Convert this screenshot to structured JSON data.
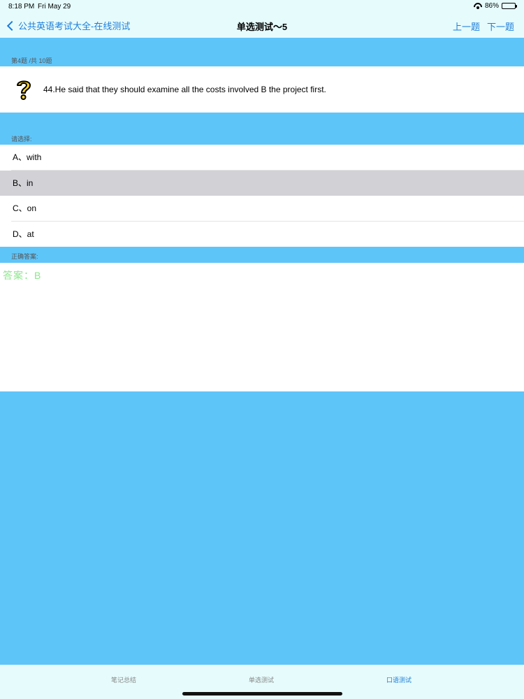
{
  "status": {
    "time": "8:18 PM",
    "date": "Fri May 29",
    "battery": "86%",
    "battery_level": 0.86
  },
  "nav": {
    "back_label": "公共英语考试大全-在线测试",
    "title": "单选测试～5",
    "prev_label": "上一题",
    "next_label": "下一题"
  },
  "progress_label": "第4题 /共 10题",
  "question": {
    "text": "44.He said that they should examine all the costs involved  B  the project first."
  },
  "choose_label": "请选择:",
  "options": [
    {
      "label": "A、with",
      "selected": false
    },
    {
      "label": "B、in",
      "selected": true
    },
    {
      "label": "C、on",
      "selected": false
    },
    {
      "label": "D、at",
      "selected": false
    }
  ],
  "answer_label": "正确答案:",
  "answer_text": "答案：B",
  "colors": {
    "accent": "#1e7ed8",
    "background": "#5ec5f9",
    "bar": "#e6fbfc",
    "answer": "#8be68b",
    "selected": "#d1d1d6"
  },
  "tabs": [
    {
      "label": "笔记总结",
      "active": false
    },
    {
      "label": "单选测试",
      "active": false
    },
    {
      "label": "口语测试",
      "active": true
    }
  ]
}
